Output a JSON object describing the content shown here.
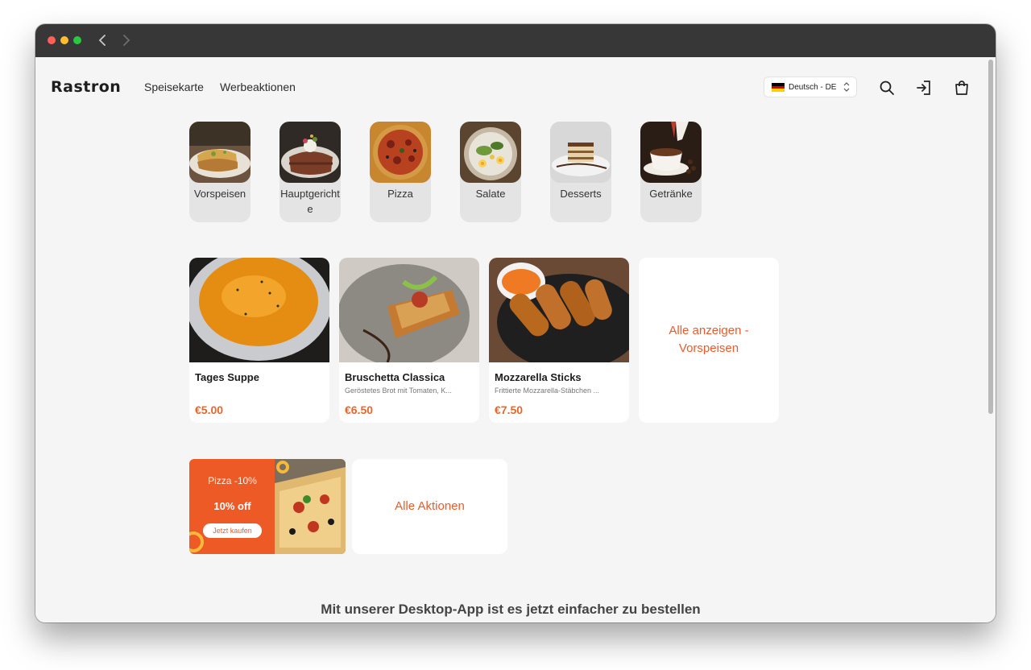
{
  "header": {
    "logo": "Rastron",
    "menu": [
      "Speisekarte",
      "Werbeaktionen"
    ],
    "language": "Deutsch - DE",
    "icons": [
      "search-icon",
      "login-icon",
      "shopping-bag-icon"
    ]
  },
  "categories": [
    {
      "label": "Vorspeisen"
    },
    {
      "label": "Hauptgerichte"
    },
    {
      "label": "Pizza"
    },
    {
      "label": "Salate"
    },
    {
      "label": "Desserts"
    },
    {
      "label": "Getränke"
    }
  ],
  "products": [
    {
      "name": "Tages Suppe",
      "description": "",
      "price": "€5.00"
    },
    {
      "name": "Bruschetta Classica",
      "description": "Geröstetes Brot mit Tomaten, K...",
      "price": "€6.50"
    },
    {
      "name": "Mozzarella Sticks",
      "description": "Frittierte Mozzarella-Stäbchen ...",
      "price": "€7.50"
    }
  ],
  "show_all_products": "Alle anzeigen - Vorspeisen",
  "promo": {
    "title": "Pizza -10%",
    "discount": "10% off",
    "button": "Jetzt kaufen"
  },
  "all_actions": "Alle Aktionen",
  "footer": "Mit unserer Desktop-App ist es jetzt einfacher zu bestellen",
  "colors": {
    "accent": "#ee5a2a",
    "price": "#e8662a",
    "titlebar": "#373737",
    "background": "#f5f5f5"
  }
}
